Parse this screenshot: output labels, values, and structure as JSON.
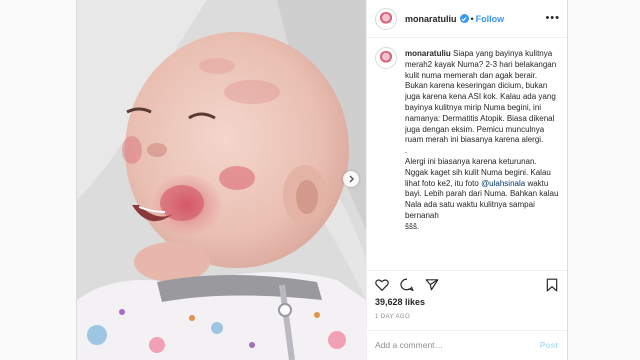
{
  "header": {
    "username": "monaratuliu",
    "separator": "•",
    "follow_label": "Follow",
    "more_icon": "more-horizontal-icon"
  },
  "caption": {
    "username": "monaratuliu",
    "paragraph1": "Siapa yang bayinya kulitnya merah2 kayak Numa? 2-3 hari belakangan kulit numa memerah dan agak berair. Bukan karena keseringan dicium, bukan juga karena kena ASI kok. Kalau ada yang bayinya kulitnya mirip Numa begini, ini namanya: Dermatitis Atopik. Biasa dikenal juga dengan eksim. Pemicu munculnya ruam merah ini biasanya karena alergi.",
    "separator_line": ".",
    "paragraph2_part1": "Alergi ini biasanya karena keturunan. Nggak kaget sih kulit Numa begini. Kalau lihat foto ke2, itu foto",
    "mention": "@ulahsinala",
    "paragraph2_part2": "waktu bayi. Lebih parah dari Numa. Bahkan kalau Nala ada satu waktu kulitnya sampai bernanah",
    "trailing": "ššš."
  },
  "actions": {
    "like_icon": "heart-icon",
    "comment_icon": "comment-icon",
    "share_icon": "share-icon",
    "save_icon": "bookmark-icon"
  },
  "likes": "39,628 likes",
  "date": "1 DAY AGO",
  "comment": {
    "placeholder": "Add a comment…",
    "post_label": "Post"
  },
  "media": {
    "next_icon": "chevron-right-icon"
  },
  "colors": {
    "link_blue": "#3897f0",
    "text": "#262626",
    "muted": "#8e8e8e",
    "border": "#dbdbdb"
  }
}
